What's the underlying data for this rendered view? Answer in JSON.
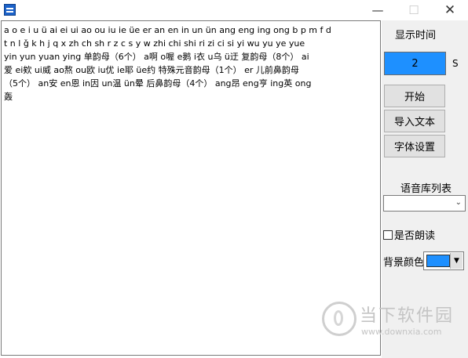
{
  "window": {
    "minimize_glyph": "—",
    "maximize_glyph": "☐",
    "close_glyph": "✕"
  },
  "editor": {
    "lines": [
      "a o e i u ü ai ei ui ao ou iu ie üe er an en in un ün ang eng ing ong b p m f d",
      "t n l ǧ k h j q x zh ch sh r z c s y w zhi chi shi ri zi ci si yi wu yu ye yue",
      "yin yun yuan ying  单韵母（6个） a啊  o喔  e鹅  i衣  u乌  ü迂 复韵母（8个）  ai",
      "爱  ei欸  ui威  ao熬  ou欧  iu优  ie耶  üe约 特殊元音韵母（1个）  er  儿前鼻韵母",
      "（5个）  an安  en恩  in因  un温  ün晕 后鼻韵母（4个）  ang昂  eng亨  ing英  ong",
      "轰"
    ]
  },
  "panel": {
    "show_time_label": "显示时间",
    "time_value": "2",
    "time_unit": "S",
    "start_button": "开始",
    "import_button": "导入文本",
    "font_button": "字体设置",
    "voice_list_label": "语音库列表",
    "voice_selected": "",
    "read_aloud_label": "是否朗读",
    "read_aloud_checked": false,
    "background_color_label": "背景颜色",
    "background_color": "#1E90FF"
  },
  "watermark": {
    "text": "当下软件园",
    "url": "www.downxia.com"
  }
}
